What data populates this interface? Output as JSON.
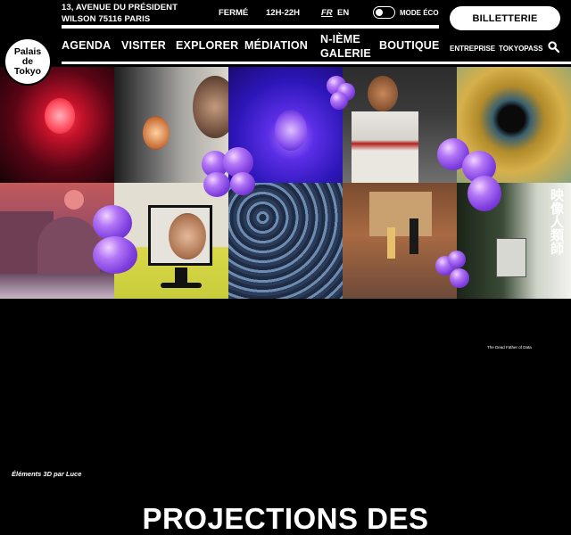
{
  "header": {
    "logo_text": "Palais\nde\nTokyo",
    "address": "13, AVENUE DU PRÉSIDENT WILSON 75116 PARIS",
    "status": "FERMÉ",
    "hours": "12H-22H",
    "lang_fr": "FR",
    "lang_en": "EN",
    "eco_label": "MODE ÉCO",
    "ticket_label": "BILLETTERIE"
  },
  "nav": {
    "agenda": "AGENDA",
    "visiter": "VISITER",
    "explorer": "EXPLORER",
    "mediation": "MÉDIATION",
    "galerie": "N-IÈME GALERIE",
    "boutique": "BOUTIQUE",
    "entreprise": "ENTREPRISE",
    "tokyopass": "TOKYOPASS"
  },
  "grid": {
    "kanji": "映像人類師",
    "small_caption": "The Dead Father of Data"
  },
  "footer": {
    "credit": "Éléments 3D par Luce",
    "headline": "PROJECTIONS DES"
  }
}
